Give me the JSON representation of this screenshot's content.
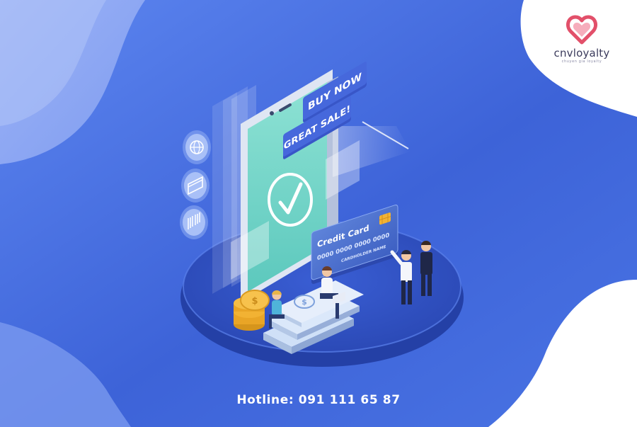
{
  "brand": {
    "name": "cnvloyalty",
    "tagline": "chuyen gia loyalty",
    "logo_icon": "heart-logo-icon",
    "accent_color": "#e2506a"
  },
  "illustration": {
    "buy_now_label": "BUY NOW",
    "great_sale_label": "GREAT SALE!",
    "card_title": "Credit Card",
    "card_number": "0000 0000 0000 0000",
    "card_holder": "CARDHOLDER NAME",
    "side_icons": [
      "globe-icon",
      "credit-card-icon",
      "barcode-icon"
    ],
    "center_icon": "check-icon",
    "colors": {
      "background": "#4a72e0",
      "platform": "#2f4fc0",
      "phone_screen": "#74d6c6",
      "coin": "#f2b233"
    }
  },
  "footer": {
    "hotline": "Hotline: 091 111 65 87"
  }
}
